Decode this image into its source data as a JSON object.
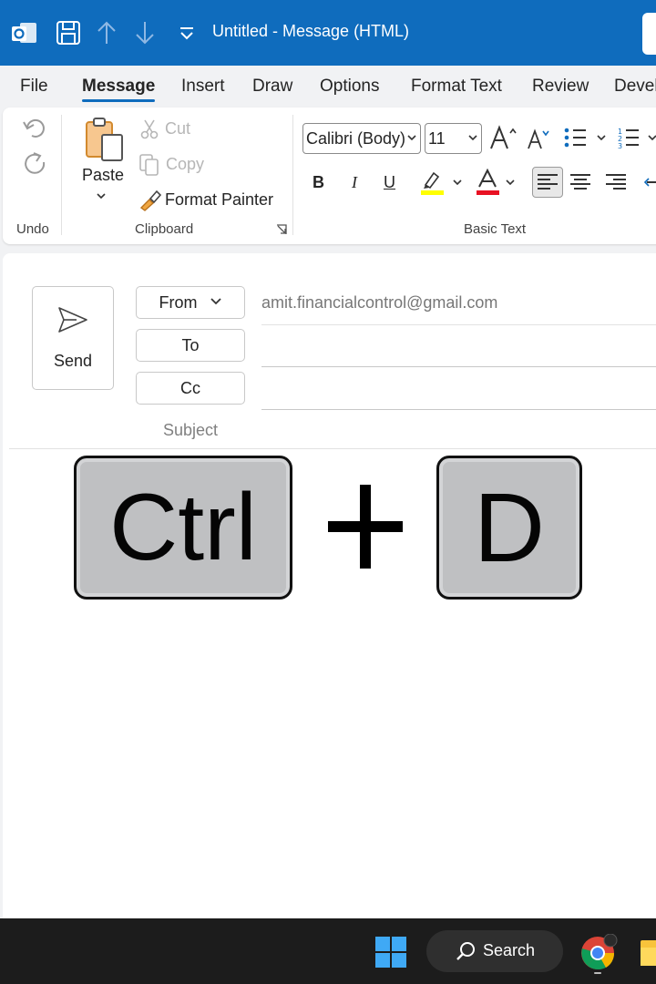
{
  "titlebar": {
    "title": "Untitled  -  Message (HTML)"
  },
  "menu": {
    "tabs": [
      "File",
      "Message",
      "Insert",
      "Draw",
      "Options",
      "Format Text",
      "Review",
      "Devel"
    ],
    "active": "Message"
  },
  "ribbon": {
    "undo_group": "Undo",
    "clipboard": {
      "paste": "Paste",
      "cut": "Cut",
      "copy": "Copy",
      "format_painter": "Format Painter",
      "group": "Clipboard"
    },
    "basic_text": {
      "font": "Calibri (Body)",
      "size": "11",
      "bold": "B",
      "italic": "I",
      "underline": "U",
      "group": "Basic Text",
      "highlight_color": "#ffff00",
      "font_color": "#e81123"
    }
  },
  "compose": {
    "send": "Send",
    "from": "From",
    "from_email": "amit.financialcontrol@gmail.com",
    "to": "To",
    "cc": "Cc",
    "subject": "Subject"
  },
  "shortcut": {
    "key1": "Ctrl",
    "key2": "D"
  },
  "taskbar": {
    "search": "Search"
  },
  "colors": {
    "accent": "#0f6cbd",
    "taskbar": "#1c1c1c"
  }
}
